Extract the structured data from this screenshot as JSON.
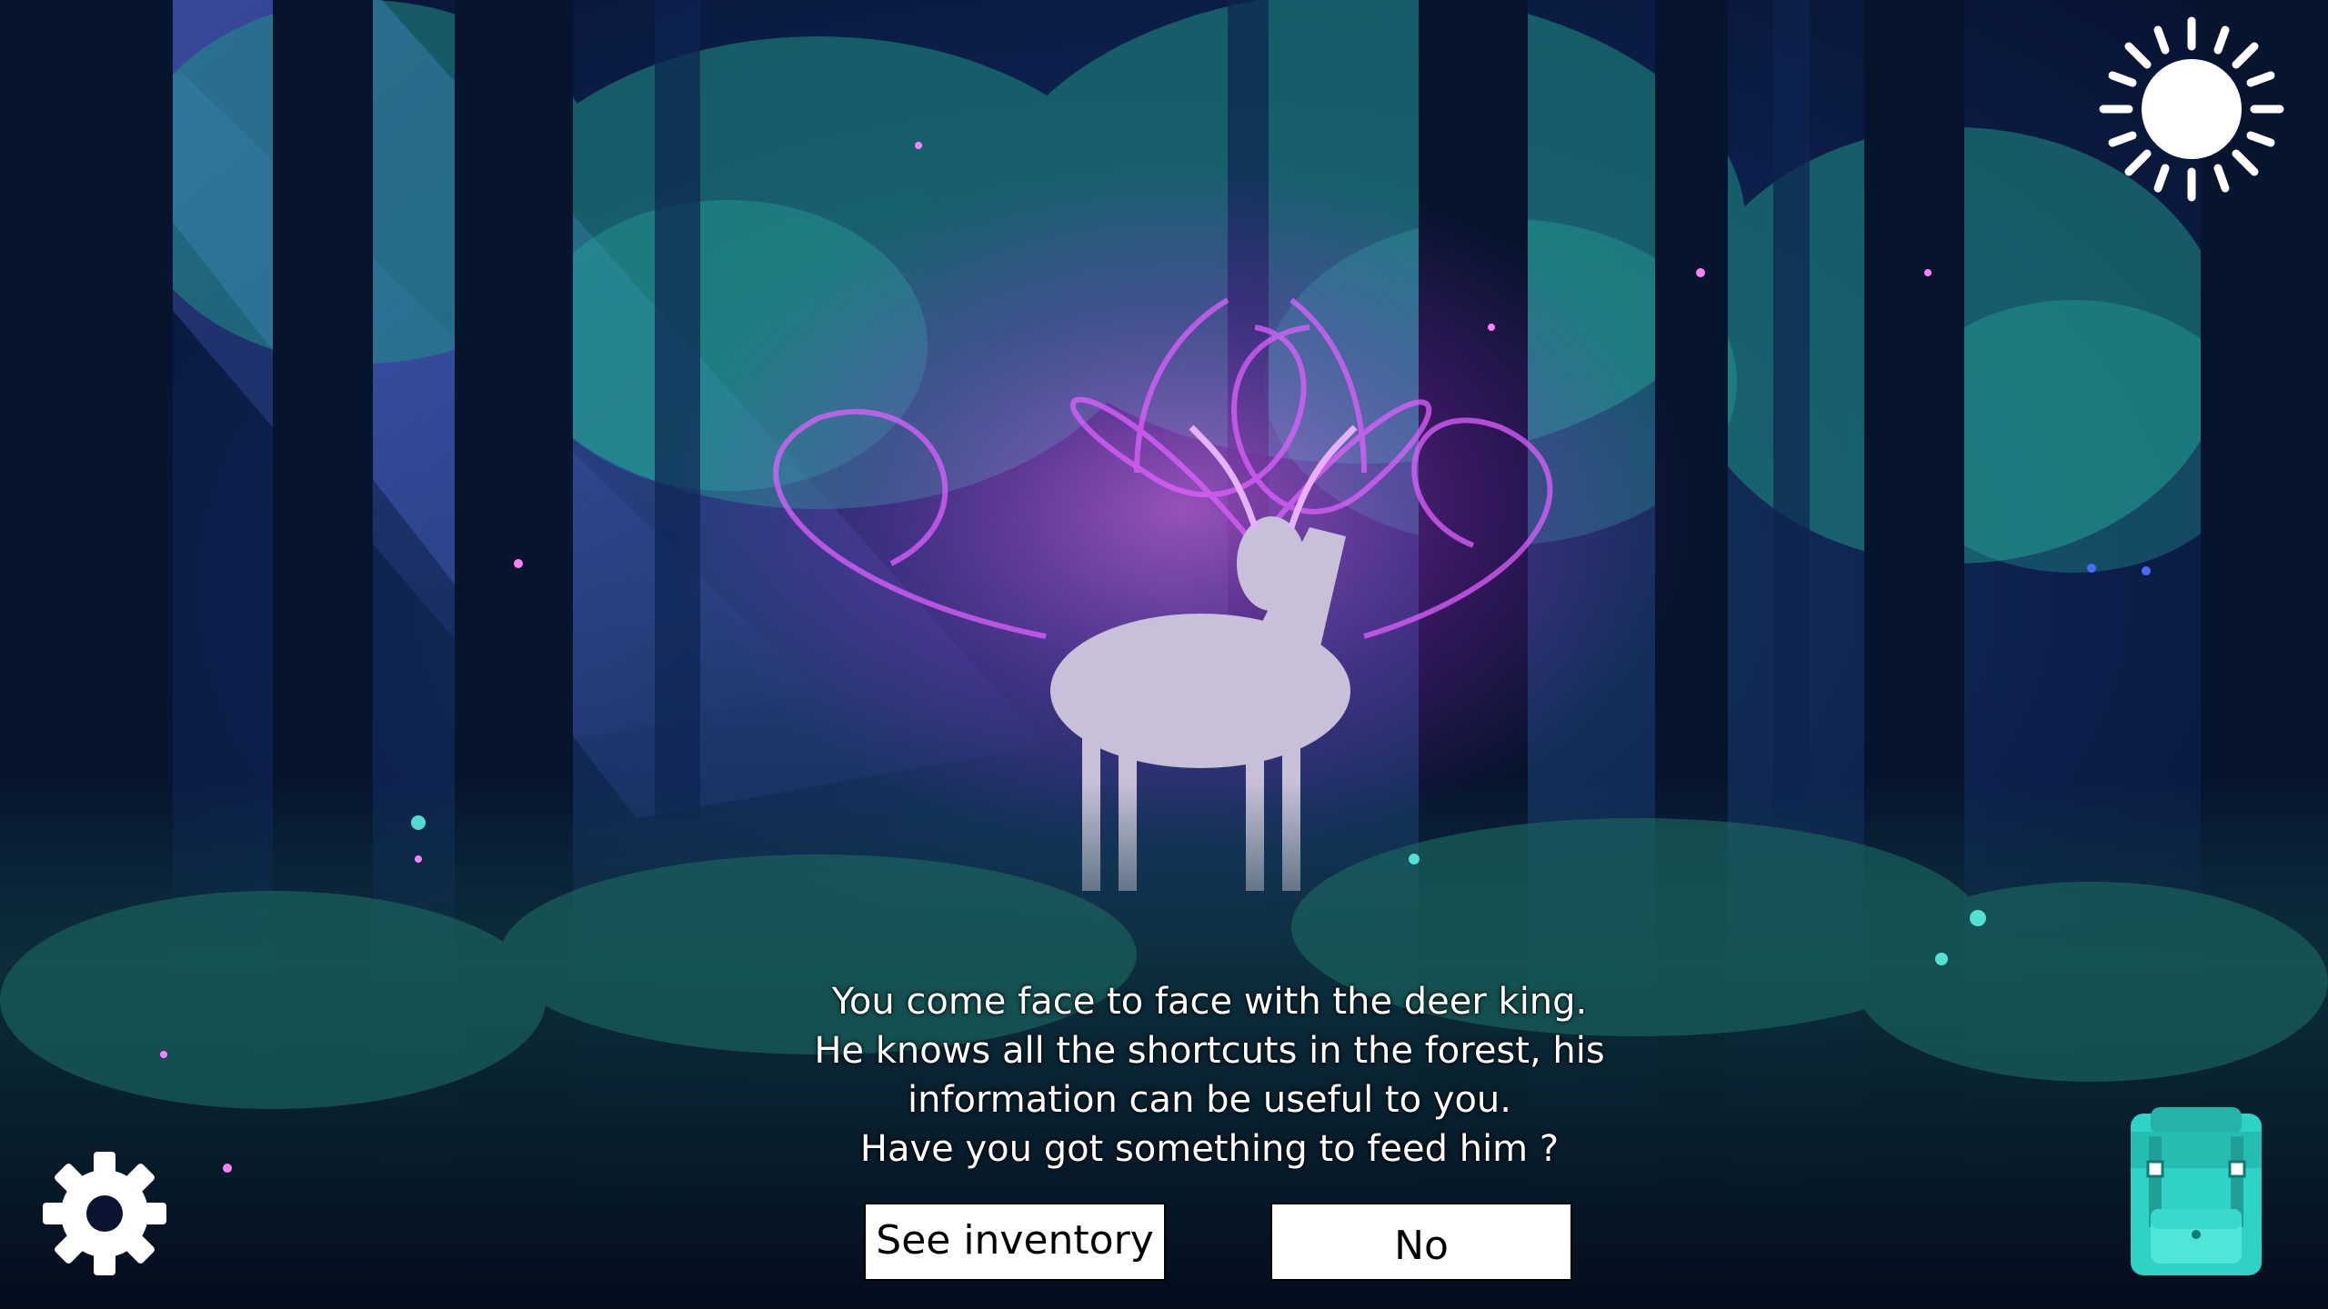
{
  "scene": {
    "background": "dark-enchanted-forest-with-glowing-stag",
    "colors": {
      "night_blue": "#0b1a5c",
      "teal_foliage": "#2fd1b8",
      "magenta_aura": "#d23cff",
      "button_white": "#ffffff",
      "backpack_teal": "#2ed3c6"
    }
  },
  "hud": {
    "sun_icon": "sun-icon",
    "settings_icon": "gear-icon",
    "inventory_icon": "backpack-icon"
  },
  "dialog": {
    "lines": [
      "You come face to face with the deer king.",
      "He knows all the shortcuts in the forest, his",
      "information can be useful to you.",
      "Have you got something to feed him ?"
    ]
  },
  "choices": {
    "inventory_label": "See inventory",
    "no_label": "No"
  }
}
